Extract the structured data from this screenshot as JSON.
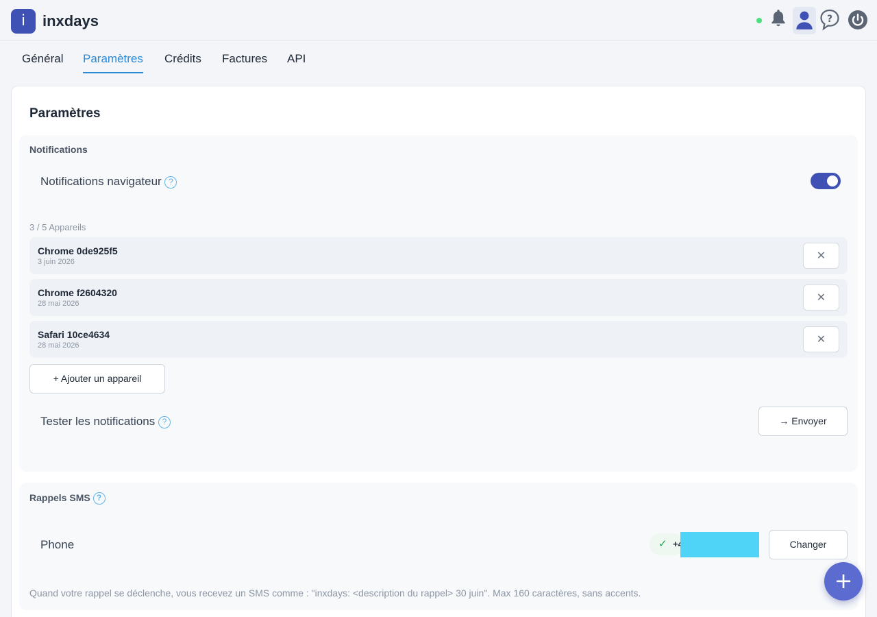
{
  "app": {
    "logo_letter": "i",
    "name": "inxdays"
  },
  "header": {
    "status_color": "#4ade80",
    "icons": [
      "bell-icon",
      "user-icon",
      "help-bubble-icon",
      "power-icon"
    ]
  },
  "tabs": [
    {
      "label": "Général",
      "active": false
    },
    {
      "label": "Paramètres",
      "active": true
    },
    {
      "label": "Crédits",
      "active": false
    },
    {
      "label": "Factures",
      "active": false
    },
    {
      "label": "API",
      "active": false
    }
  ],
  "page": {
    "title": "Paramètres"
  },
  "notifications": {
    "section_label": "Notifications",
    "browser_label": "Notifications navigateur",
    "browser_enabled": true,
    "devices_count": "3 / 5 Appareils",
    "devices": [
      {
        "name": "Chrome 0de925f5",
        "date": "3 juin 2026"
      },
      {
        "name": "Chrome f2604320",
        "date": "28 mai 2026"
      },
      {
        "name": "Safari 10ce4634",
        "date": "28 mai 2026"
      }
    ],
    "add_device_label": "+ Ajouter un appareil",
    "test_label": "Tester les notifications",
    "send_label": "→ Envoyer"
  },
  "sms": {
    "section_label": "Rappels SMS",
    "phone_label": "Phone",
    "phone_value": "+4",
    "change_label": "Changer",
    "footnote": "Quand votre rappel se déclenche, vous recevez un SMS comme : \"inxdays: <description du rappel> 30 juin\". Max 160 caractères, sans accents."
  },
  "colors": {
    "accent": "#3f51b5",
    "link": "#2b8ad6",
    "fab": "#5c6bd0",
    "success": "#22a355"
  },
  "fab": {
    "label": "+"
  }
}
